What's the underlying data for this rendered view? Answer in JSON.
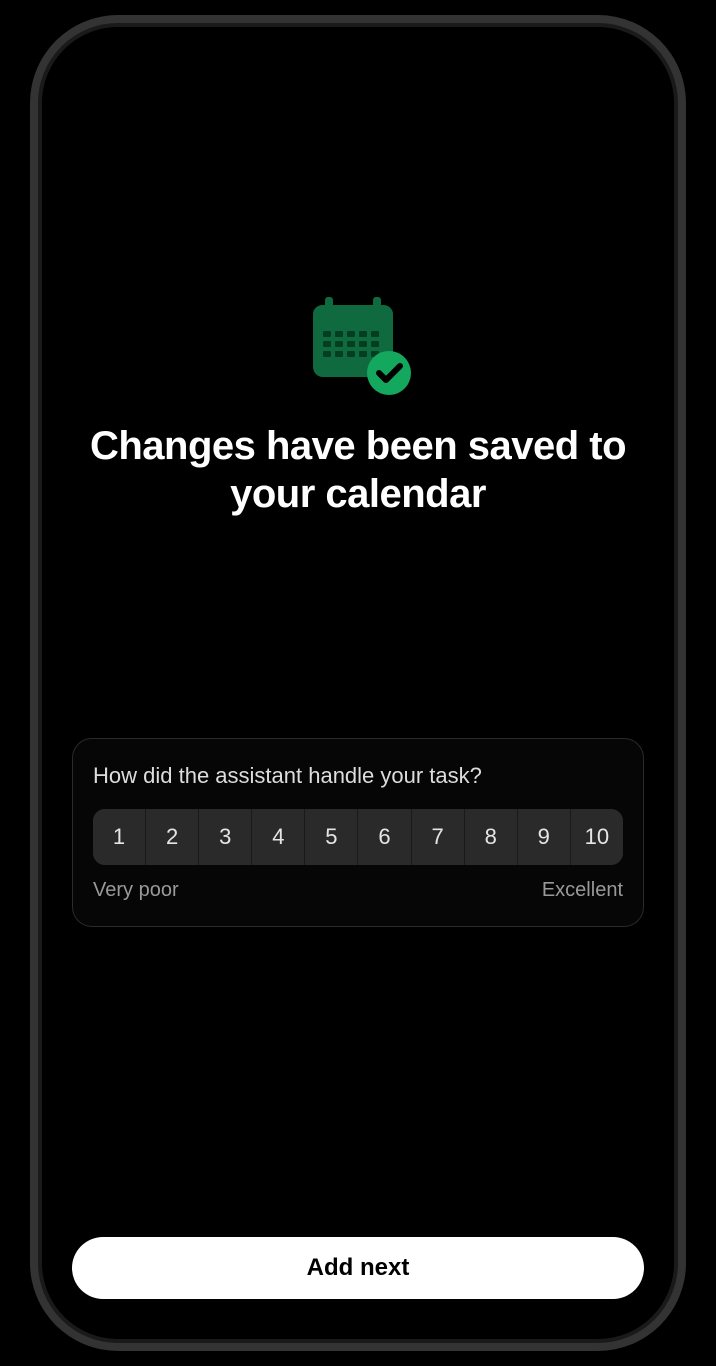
{
  "colors": {
    "accent": "#0f8a4f",
    "accent_bright": "#14a85f"
  },
  "hero": {
    "icon": "calendar-check-icon",
    "heading": "Changes have been saved to your calendar"
  },
  "rating": {
    "question": "How did the assistant handle your task?",
    "options": [
      "1",
      "2",
      "3",
      "4",
      "5",
      "6",
      "7",
      "8",
      "9",
      "10"
    ],
    "label_low": "Very poor",
    "label_high": "Excellent"
  },
  "footer": {
    "primary_label": "Add next"
  }
}
